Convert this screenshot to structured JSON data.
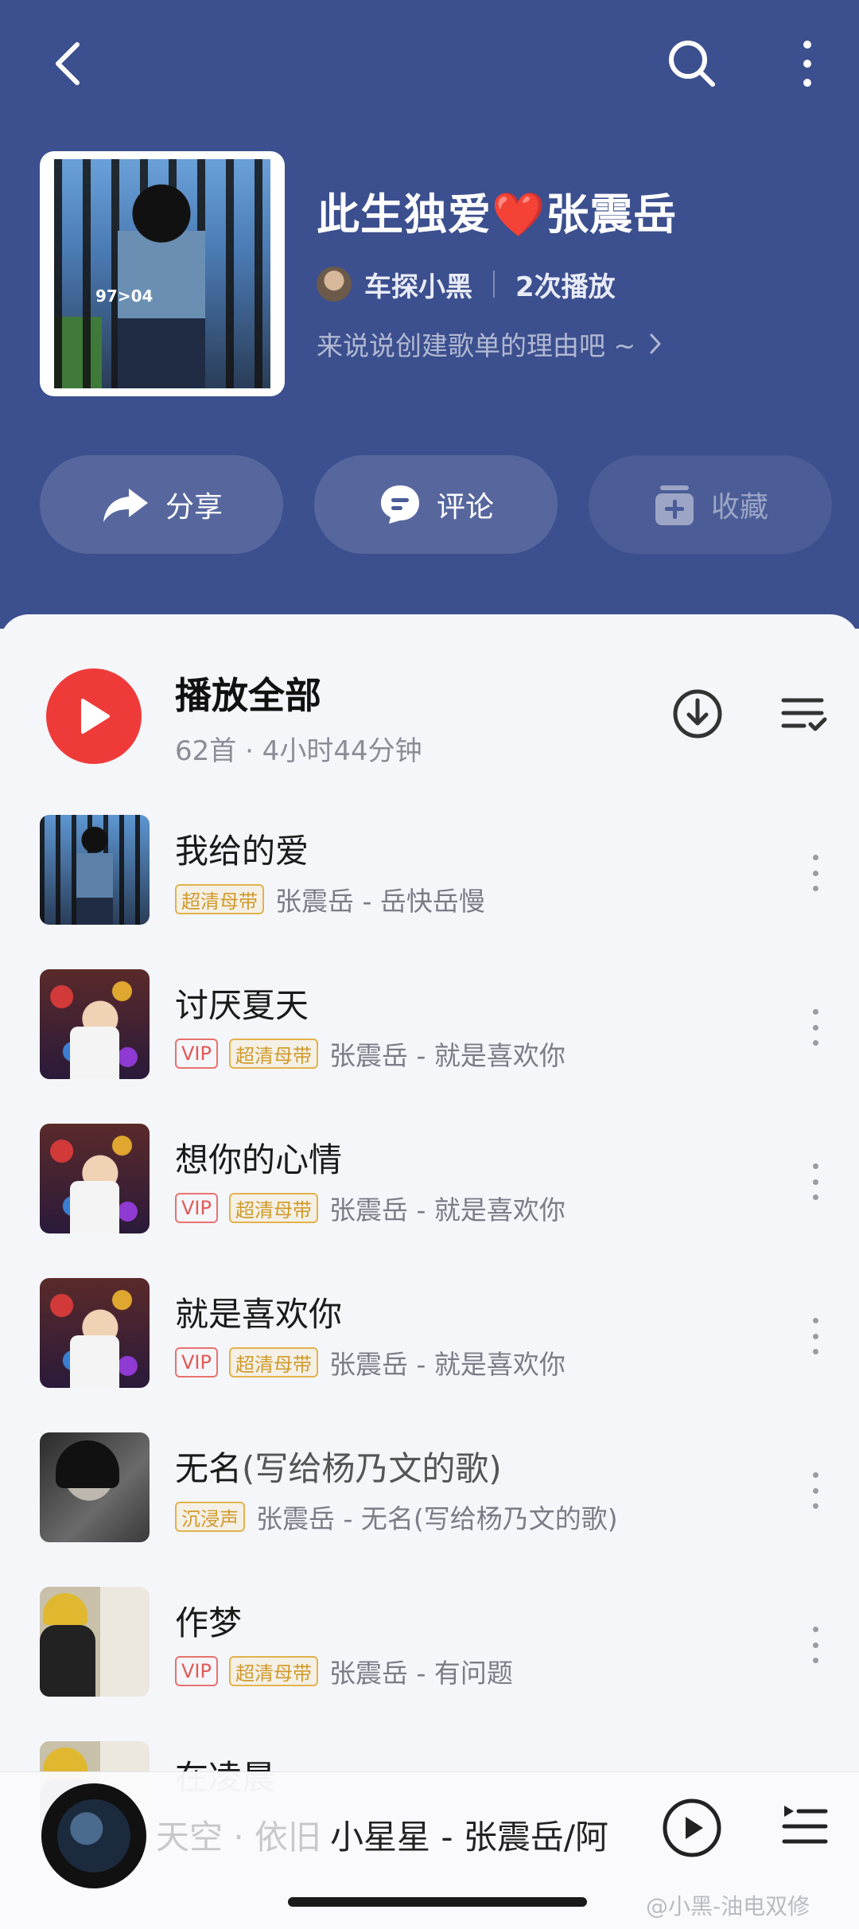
{
  "header": {
    "title": "此生独爱",
    "title_heart": "❤️",
    "title_suffix": "张震岳",
    "creator": "车探小黑",
    "plays": "2次播放",
    "description": "来说说创建歌单的理由吧 ~",
    "bg_color": "#3c4f8e"
  },
  "cover": {
    "text_97": "97>04"
  },
  "actions": {
    "share": "分享",
    "comment": "评论",
    "favorite": "收藏"
  },
  "play_all": {
    "label": "播放全部",
    "meta": "62首 · 4小时44分钟",
    "accent": "#ee3b3a"
  },
  "songs": [
    {
      "title": "我给的爱",
      "tags": [
        "超清母带"
      ],
      "artist_album": "张震岳 - 岳快岳慢"
    },
    {
      "title": "讨厌夏天",
      "tags": [
        "VIP",
        "超清母带"
      ],
      "artist_album": "张震岳 - 就是喜欢你"
    },
    {
      "title": "想你的心情",
      "tags": [
        "VIP",
        "超清母带"
      ],
      "artist_album": "张震岳 - 就是喜欢你"
    },
    {
      "title": "就是喜欢你",
      "tags": [
        "VIP",
        "超清母带"
      ],
      "artist_album": "张震岳 - 就是喜欢你"
    },
    {
      "title": "无名",
      "title_paren": "(写给杨乃文的歌)",
      "tags": [
        "沉浸声"
      ],
      "artist_album": "张震岳 - 无名(写给杨乃文的歌)"
    },
    {
      "title": "作梦",
      "tags": [
        "VIP",
        "超清母带"
      ],
      "artist_album": "张震岳 - 有问题"
    },
    {
      "title": "在凌晨"
    }
  ],
  "player": {
    "now_playing": "小星星 - 张震岳/阿",
    "ghost_text": "天空 · 依旧"
  },
  "watermark": "@小黑-油电双修"
}
